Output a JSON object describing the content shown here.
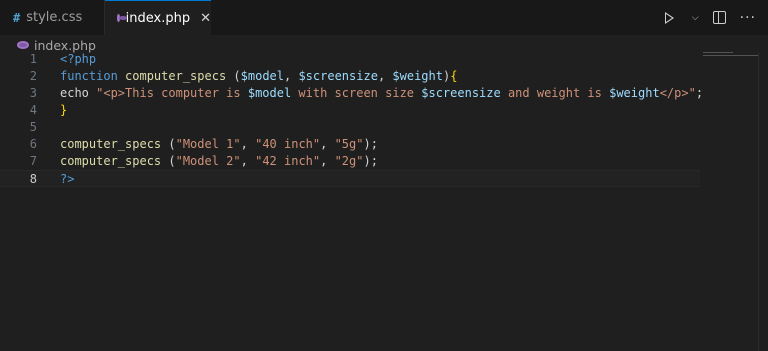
{
  "tabs": [
    {
      "label": "style.css",
      "icon": "css-file-icon",
      "active": false
    },
    {
      "label": "index.php",
      "icon": "php-file-icon",
      "active": true
    }
  ],
  "breadcrumb": {
    "file": "index.php"
  },
  "editor": {
    "active_line": 8,
    "lines": [
      {
        "num": "1",
        "parts": [
          {
            "t": "<?php",
            "c": "k-tag"
          }
        ]
      },
      {
        "num": "2",
        "parts": [
          {
            "t": "function ",
            "c": "k-fn"
          },
          {
            "t": "computer_specs",
            "c": "k-name"
          },
          {
            "t": " (",
            "c": "k-plain"
          },
          {
            "t": "$model",
            "c": "k-var"
          },
          {
            "t": ", ",
            "c": "k-plain"
          },
          {
            "t": "$screensize",
            "c": "k-var"
          },
          {
            "t": ", ",
            "c": "k-plain"
          },
          {
            "t": "$weight",
            "c": "k-var"
          },
          {
            "t": ")",
            "c": "k-plain"
          },
          {
            "t": "{",
            "c": "k-brace1"
          }
        ]
      },
      {
        "num": "3",
        "parts": [
          {
            "t": "echo ",
            "c": "k-plain"
          },
          {
            "t": "\"<p>This computer is ",
            "c": "k-str"
          },
          {
            "t": "$model",
            "c": "k-var"
          },
          {
            "t": " with screen size ",
            "c": "k-str"
          },
          {
            "t": "$screensize",
            "c": "k-var"
          },
          {
            "t": " and weight is ",
            "c": "k-str"
          },
          {
            "t": "$weight",
            "c": "k-var"
          },
          {
            "t": "</p>\"",
            "c": "k-str"
          },
          {
            "t": ";",
            "c": "k-plain"
          }
        ]
      },
      {
        "num": "4",
        "parts": [
          {
            "t": "}",
            "c": "k-brace1"
          }
        ]
      },
      {
        "num": "5",
        "parts": []
      },
      {
        "num": "6",
        "parts": [
          {
            "t": "computer_specs",
            "c": "k-name"
          },
          {
            "t": " (",
            "c": "k-plain"
          },
          {
            "t": "\"Model 1\"",
            "c": "k-str"
          },
          {
            "t": ", ",
            "c": "k-plain"
          },
          {
            "t": "\"40 inch\"",
            "c": "k-str"
          },
          {
            "t": ", ",
            "c": "k-plain"
          },
          {
            "t": "\"5g\"",
            "c": "k-str"
          },
          {
            "t": ");",
            "c": "k-plain"
          }
        ]
      },
      {
        "num": "7",
        "parts": [
          {
            "t": "computer_specs",
            "c": "k-name"
          },
          {
            "t": " (",
            "c": "k-plain"
          },
          {
            "t": "\"Model 2\"",
            "c": "k-str"
          },
          {
            "t": ", ",
            "c": "k-plain"
          },
          {
            "t": "\"42 inch\"",
            "c": "k-str"
          },
          {
            "t": ", ",
            "c": "k-plain"
          },
          {
            "t": "\"2g\"",
            "c": "k-str"
          },
          {
            "t": ");",
            "c": "k-plain"
          }
        ]
      },
      {
        "num": "8",
        "parts": [
          {
            "t": "?>",
            "c": "k-tag"
          }
        ]
      }
    ]
  },
  "toolbar": {
    "run_icon": "run-icon",
    "dropdown_icon": "chevron-down-icon",
    "split_icon": "split-editor-icon",
    "more_icon": "more-actions-icon"
  },
  "colors": {
    "background": "#1f1f1f",
    "tabbar": "#181818",
    "accent": "#0078d4"
  }
}
